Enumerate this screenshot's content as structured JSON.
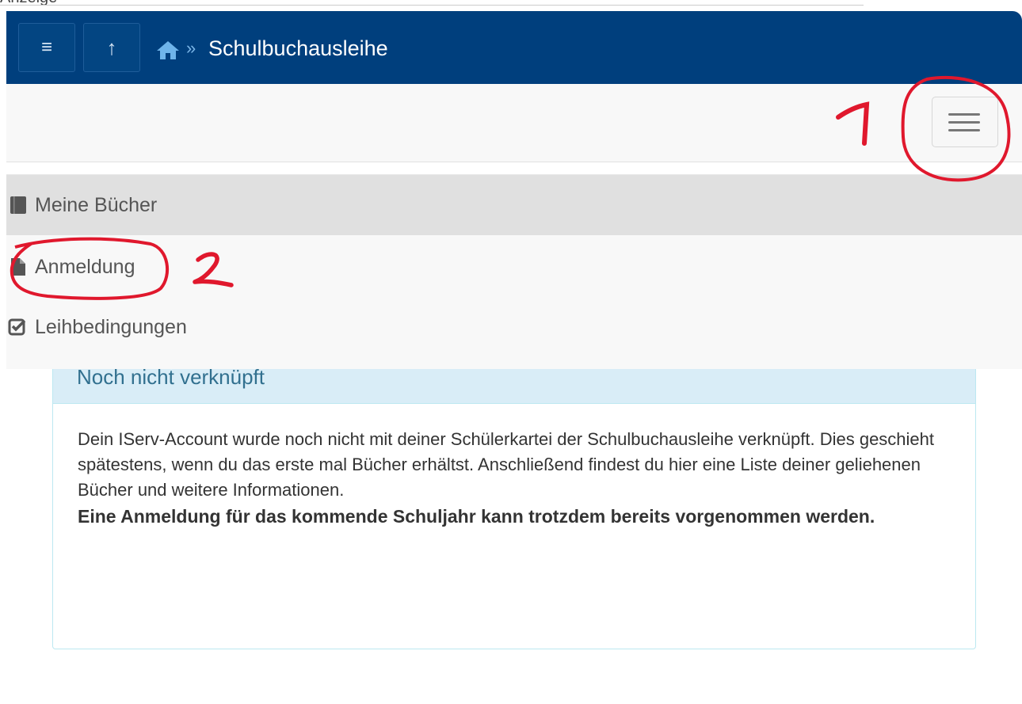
{
  "top_clip_text": "Anzeige",
  "header": {
    "menu_icon": "menu-icon",
    "up_icon": "arrow-up-icon",
    "home_icon": "home-icon",
    "separator": "»",
    "title": "Schulbuchausleihe"
  },
  "navbar": {
    "toggle_icon": "hamburger-icon"
  },
  "menu": {
    "items": [
      {
        "label": "Meine Bücher",
        "icon": "book-icon",
        "active": true
      },
      {
        "label": "Anmeldung",
        "icon": "file-icon",
        "active": false
      },
      {
        "label": "Leihbedingungen",
        "icon": "check-square-icon",
        "active": false
      }
    ]
  },
  "panel": {
    "heading": "Noch nicht verknüpft",
    "body_text": "Dein IServ-Account wurde noch nicht mit deiner Schülerkartei der Schulbuchausleihe verknüpft. Dies geschieht spätestens, wenn du das erste mal Bücher erhältst. Anschließend findest du hier eine Liste deiner geliehenen Bücher und weitere Informationen.",
    "body_bold": "Eine Anmeldung für das kommende Schuljahr kann trotzdem bereits vorgenommen werden."
  },
  "annotations": {
    "marker_1": "1",
    "marker_2": "2",
    "color": "#e0182d"
  },
  "colors": {
    "header_bg": "#003f7d",
    "info_heading_bg": "#d9edf7",
    "info_text": "#31708f"
  }
}
